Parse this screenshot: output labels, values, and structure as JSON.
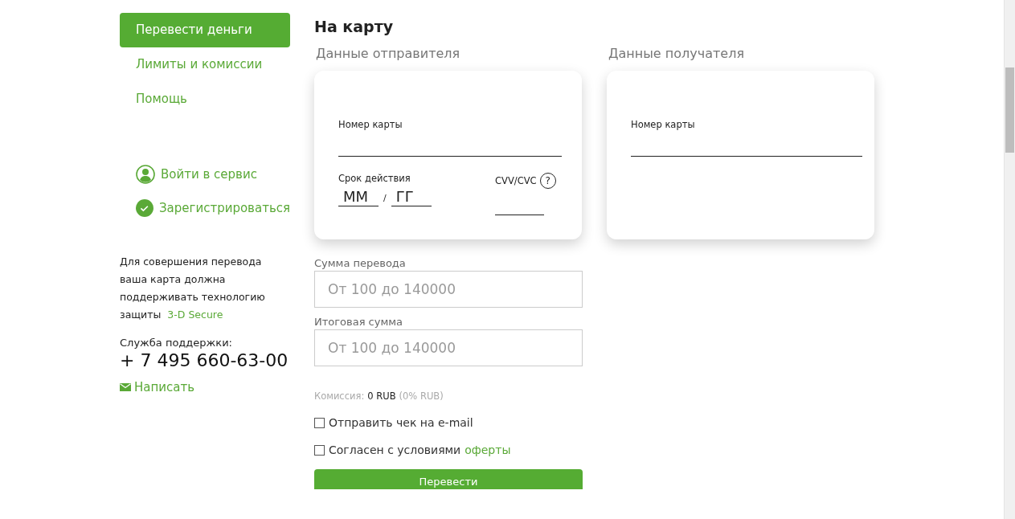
{
  "sidebar": {
    "nav": [
      {
        "label": "Перевести деньги",
        "selected": true
      },
      {
        "label": "Лимиты и комиссии",
        "selected": false
      },
      {
        "label": "Помощь",
        "selected": false
      }
    ],
    "auth_links": [
      {
        "kind": "login",
        "label": "Войти в сервис"
      },
      {
        "kind": "register",
        "label": "Зарегистрироваться"
      }
    ],
    "notice": {
      "text": "Для совершения перевода ваша карта должна поддерживать технологию защиты ",
      "link": "3-D Secure"
    },
    "support": {
      "label": "Служба поддержки:",
      "phone": "+ 7 495 660-63-00",
      "write_link": "Написать"
    }
  },
  "main": {
    "title": "На карту",
    "sender": {
      "heading": "Данные отправителя",
      "card_number_label": "Номер карты",
      "expiry_label": "Срок действия",
      "month_placeholder": "ММ",
      "separator": "/",
      "year_placeholder": "ГГ",
      "cvv_label": "CVV/CVC",
      "help": "?"
    },
    "recipient": {
      "heading": "Данные получателя",
      "card_number_label": "Номер карты"
    },
    "amount": {
      "label": "Сумма перевода",
      "placeholder": "От 100 до 140000"
    },
    "total": {
      "label": "Итоговая сумма",
      "placeholder": "От 100 до 140000"
    },
    "commission": {
      "label": "Комиссия:",
      "value": "0 RUB",
      "note": "(0% RUB)"
    },
    "checkboxes": [
      {
        "label": "Отправить чек на e-mail",
        "checked": false
      },
      {
        "label": "Согласен с условиями",
        "link": "оферты",
        "checked": false
      }
    ],
    "submit": "Перевести"
  }
}
